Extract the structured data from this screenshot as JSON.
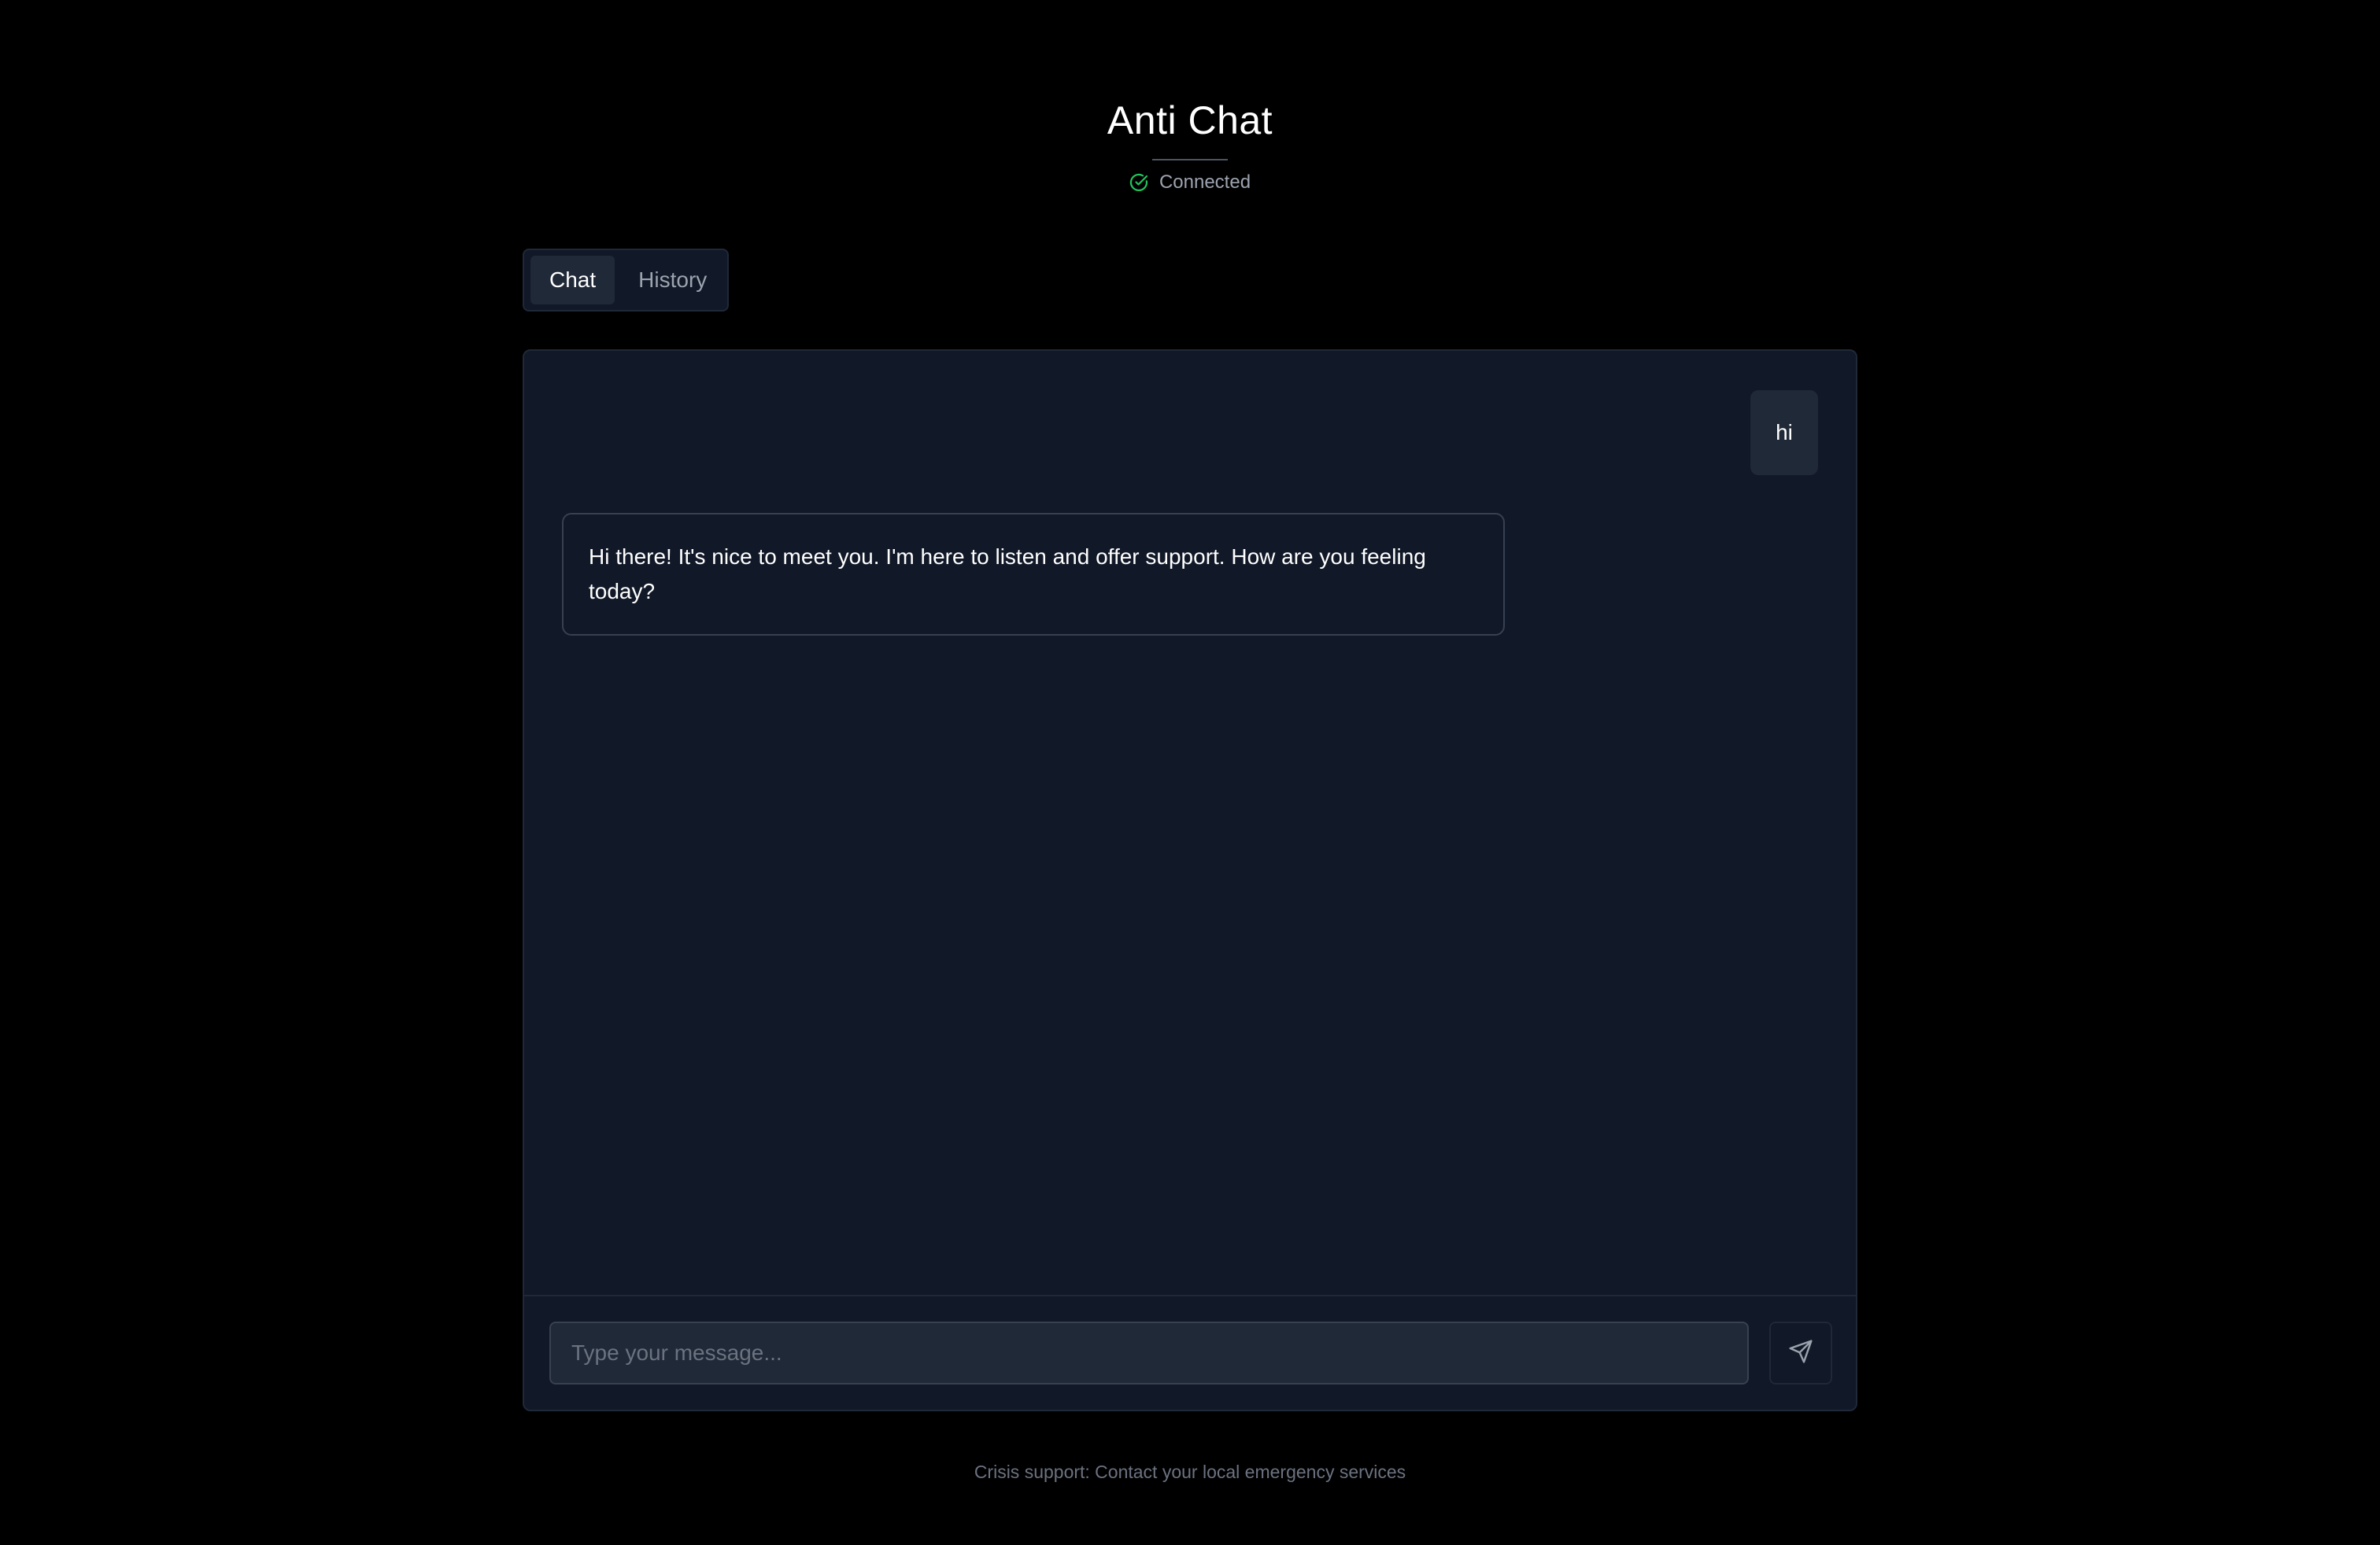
{
  "header": {
    "title": "Anti Chat",
    "status": "Connected",
    "status_icon": "check-circle-icon",
    "status_color": "#22c55e"
  },
  "tabs": [
    {
      "label": "Chat",
      "active": true
    },
    {
      "label": "History",
      "active": false
    }
  ],
  "messages": [
    {
      "role": "user",
      "text": "hi"
    },
    {
      "role": "assistant",
      "text": "Hi there! It's nice to meet you. I'm here to listen and offer support. How are you feeling today?"
    }
  ],
  "composer": {
    "placeholder": "Type your message...",
    "value": "",
    "send_icon": "send-icon"
  },
  "footer": {
    "text": "Crisis support: Contact your local emergency services"
  },
  "colors": {
    "background": "#000000",
    "panel": "#111827",
    "surface": "#1f2937",
    "border": "#374151",
    "muted_text": "#9ca3af"
  }
}
